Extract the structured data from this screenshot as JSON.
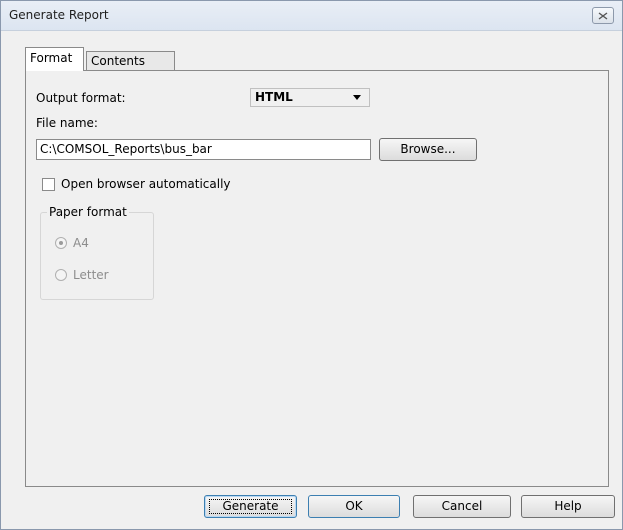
{
  "window": {
    "title": "Generate Report"
  },
  "tabs": [
    {
      "label": "Format",
      "active": true
    },
    {
      "label": "Contents",
      "active": false
    }
  ],
  "format": {
    "output_format_label": "Output format:",
    "output_format_value": "HTML",
    "file_name_label": "File name:",
    "file_name_value": "C:\\COMSOL_Reports\\bus_bar",
    "browse_label": "Browse...",
    "open_browser_label": "Open browser automatically",
    "open_browser_checked": false,
    "paper_format": {
      "title": "Paper format",
      "options": [
        {
          "label": "A4",
          "selected": true
        },
        {
          "label": "Letter",
          "selected": false
        }
      ]
    }
  },
  "footer": {
    "generate_label": "Generate",
    "ok_label": "OK",
    "cancel_label": "Cancel",
    "help_label": "Help"
  },
  "icons": {
    "close": "close-icon",
    "dropdown": "chevron-down-icon"
  }
}
